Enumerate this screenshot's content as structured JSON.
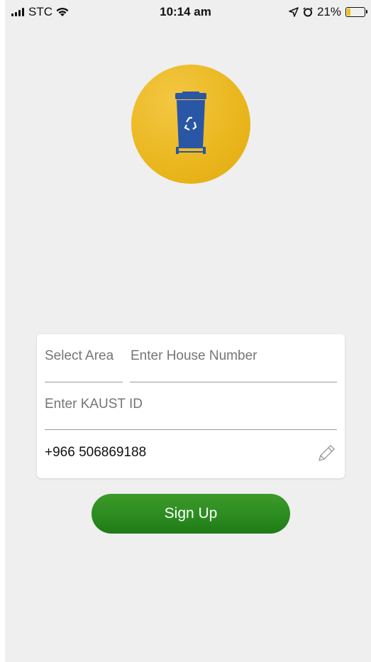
{
  "status_bar": {
    "carrier": "STC",
    "time": "10:14 am",
    "battery": "21%",
    "battery_level": 0.21
  },
  "logo": {
    "icon": "recycle-bin-icon",
    "bg_color": "#e9b61d",
    "bin_color": "#2a56a6"
  },
  "form": {
    "area_placeholder": "Select Area",
    "house_placeholder": "Enter House Number",
    "kaust_placeholder": "Enter KAUST ID",
    "phone_value": "+966 506869188",
    "edit_icon": "pencil-icon"
  },
  "signup_label": "Sign Up",
  "colors": {
    "accent": "#2a8a1f",
    "background": "#efefef"
  }
}
